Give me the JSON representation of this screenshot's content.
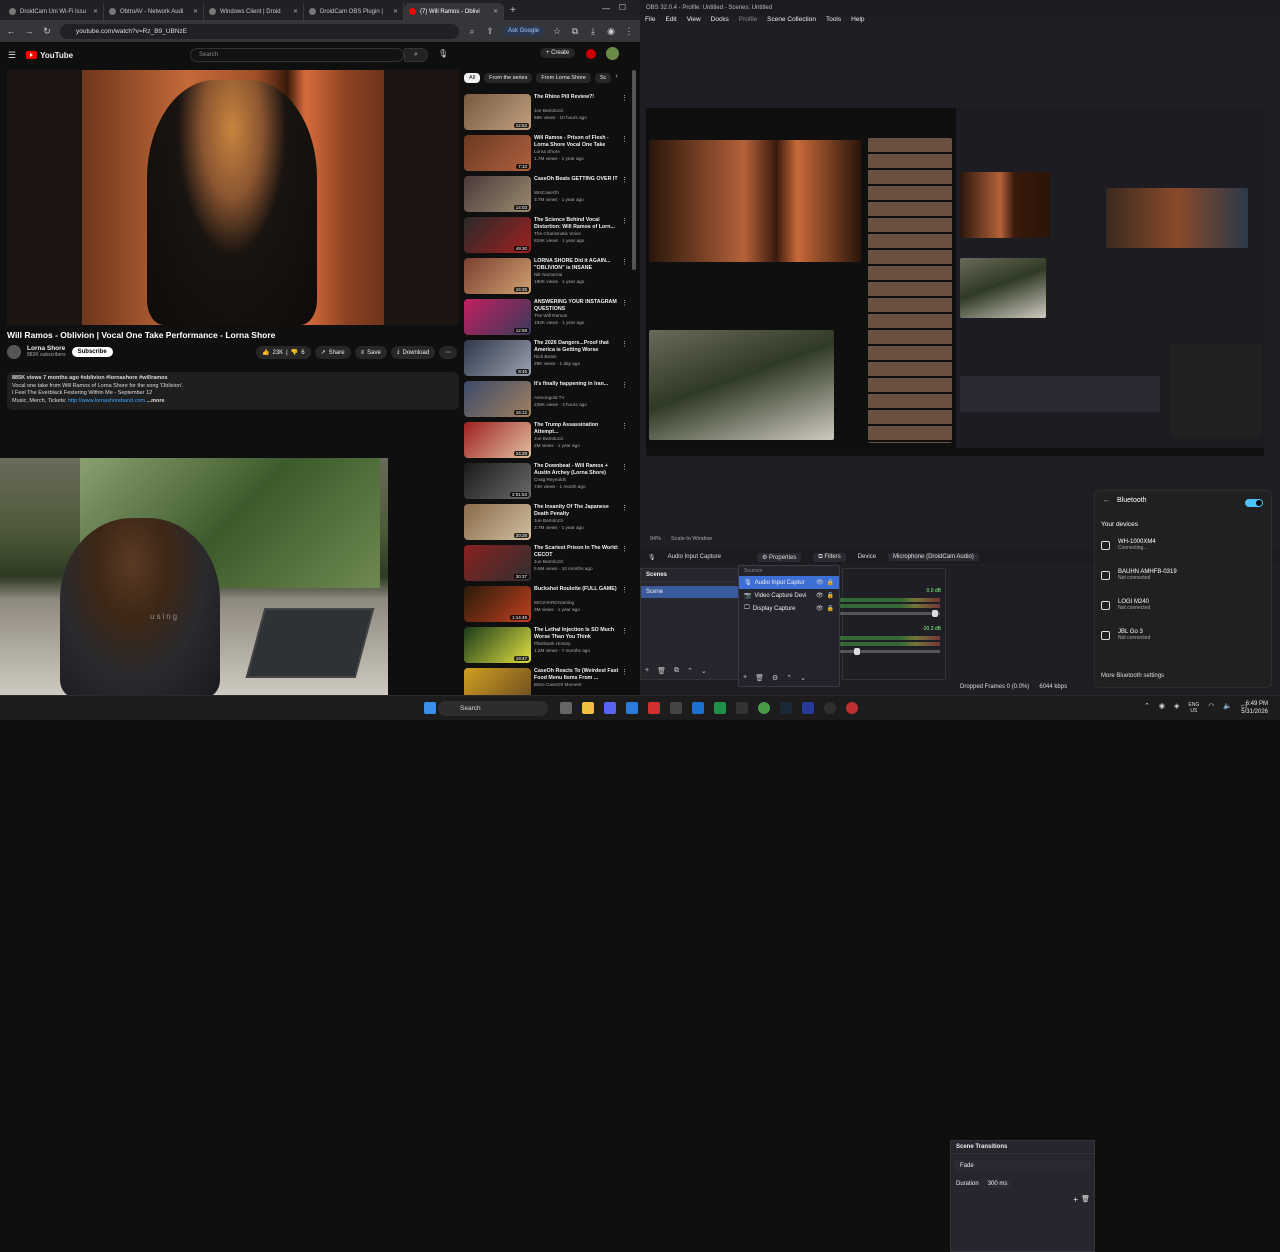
{
  "browser": {
    "tabs": [
      "DroidCam Uni Wi-Fi Issu",
      "ObtroAV - Network Audi",
      "Windows Client | Droid",
      "DroidCam OBS Plugin |",
      "(7) Will Ramos - Oblivi"
    ],
    "url": "youtube.com/watch?v=Rz_B9_UBNzE",
    "ask_google": "Ask Google"
  },
  "youtube": {
    "logo": "YouTube",
    "search_placeholder": "Search",
    "create": "+ Create",
    "video_title": "Will Ramos - Oblivion | Vocal One Take Performance - Lorna Shore",
    "channel": "Lorna Shore",
    "subs": "883K subscribers",
    "subscribe": "Subscribe",
    "likes": "23K",
    "dislikes": "6",
    "share": "Share",
    "save": "Save",
    "download": "Download",
    "desc_line1": "885K views  7 months ago  #oblivion #lornashore #willramos",
    "desc_line2": "Vocal one take from Will Ramos of Lorna Shore for the song 'Oblivion'.",
    "desc_line3": "I Feel The Everblack Festering Within Me - September 12",
    "desc_line4_prefix": "Music, Merch, Tickets: ",
    "desc_link": "http://www.lornashoreband.com",
    "desc_more": "...more",
    "chips": [
      "All",
      "From the series",
      "From Lorna Shore",
      "Sc"
    ],
    "recs": [
      {
        "title": "The Rhino Pill Review?!",
        "chan": "Joe Bartolozzi",
        "meta": "58K views · 10 hours ago",
        "dur": "12:52",
        "c1": "#7a5a40",
        "c2": "#c0a080"
      },
      {
        "title": "Will Ramos - Prison of Flesh - Lorna Shore Vocal One Take",
        "chan": "Lorna Shore",
        "meta": "1.7M views · 1 year ago",
        "dur": "7:10",
        "c1": "#6a3a20",
        "c2": "#b06040"
      },
      {
        "title": "CaseOh Beats GETTING OVER IT",
        "chan": "MrsCaseOh",
        "meta": "3.7M views · 1 year ago",
        "dur": "14:03",
        "c1": "#4a3a3a",
        "c2": "#9a8a70"
      },
      {
        "title": "The Science Behind Vocal Distortion: Will Ramos of Lorn...",
        "chan": "The Charismatic Voice",
        "meta": "816K views · 1 year ago",
        "dur": "49:30",
        "c1": "#2a2a2a",
        "c2": "#a02020"
      },
      {
        "title": "LORNA SHORE Did it AGAIN... \"OBLIVION\" is INSANE",
        "chan": "Nik Nocturnal",
        "meta": "190K views · 1 year ago",
        "dur": "16:35",
        "c1": "#7a4030",
        "c2": "#d0a070"
      },
      {
        "title": "ANSWERING YOUR INSTAGRAM QUESTIONS",
        "chan": "The Will Ramos",
        "meta": "192K views · 1 year ago",
        "dur": "12:58",
        "c1": "#c02060",
        "c2": "#3a3a5a"
      },
      {
        "title": "The 2026 Dangers...Proof that America is Getting Worse",
        "chan": "Rick Beato",
        "meta": "29K views · 1 day ago",
        "dur": "8:45",
        "c1": "#303a4a",
        "c2": "#9aa0b0"
      },
      {
        "title": "It's finally happening in Iran...",
        "chan": "Asmongold TV",
        "meta": "236K views · 3 hours ago",
        "dur": "16:12",
        "c1": "#3a4a6a",
        "c2": "#a08060"
      },
      {
        "title": "The Trump Assassination Attempt...",
        "chan": "Joe Bartolozzi",
        "meta": "2M views · 1 year ago",
        "dur": "24:29",
        "c1": "#a02020",
        "c2": "#e0c0a0"
      },
      {
        "title": "The Downbeat - Will Ramos + Austin Archey (Lorna Shore)",
        "chan": "Craig Reynolds",
        "meta": "74K views · 1 month ago",
        "dur": "2:01:53",
        "c1": "#1a1a1a",
        "c2": "#6a6a6a"
      },
      {
        "title": "The Insanity Of The Japanese Death Penalty",
        "chan": "Joe Bartolozzi",
        "meta": "3.7M views · 1 year ago",
        "dur": "20:28",
        "c1": "#8a6a4a",
        "c2": "#d0c0a0"
      },
      {
        "title": "The Scariest Prison In The World: CECOT",
        "chan": "Joe Bartolozzi",
        "meta": "5.6M views · 10 months ago",
        "dur": "30:37",
        "c1": "#8a2020",
        "c2": "#303030"
      },
      {
        "title": "Buckshot Roulette (FULL GAME)",
        "chan": "MrCrHARDGaming",
        "meta": "3M views · 1 year ago",
        "dur": "1:14:49",
        "c1": "#2a1a0a",
        "c2": "#c04020"
      },
      {
        "title": "The Lethal Injection Is SO Much Worse Than You Think",
        "chan": "Plainbank History",
        "meta": "1.2M views · 7 months ago",
        "dur": "19:47",
        "c1": "#1a3a1a",
        "c2": "#e0e040"
      },
      {
        "title": "CaseOh Reacts To (Weirdest Fast Food Menu Items From ...",
        "chan": "More CaseOh Moment",
        "meta": "",
        "dur": "",
        "c1": "#d0a020",
        "c2": "#6a4a20"
      }
    ]
  },
  "webcam": {
    "caption": "using"
  },
  "obs": {
    "title": "OBS 32.0.4 - Profile: Untitled - Scenes: Untitled",
    "menu": [
      "File",
      "Edit",
      "View",
      "Docks",
      "Profile",
      "Scene Collection",
      "Tools",
      "Help"
    ],
    "zoom": "94%",
    "scale": "Scale to Window",
    "source_name": "Audio Input Capture",
    "properties": "Properties",
    "filters": "Filters",
    "device_label": "Device",
    "device": "Microphone (DroidCam Audio)",
    "scenes_title": "Scenes",
    "scene": "Scene",
    "sources": [
      "Audio Input Captur",
      "Video Capture Devi",
      "Display Capture"
    ],
    "sources_hint": "Sources",
    "trans_title": "Scene Transitions",
    "trans_type": "Fade",
    "duration_label": "Duration",
    "duration": "300 ms",
    "db1": "0.0 dB",
    "db2": "-20.3 dB",
    "dropped": "Dropped Frames 0 (0.0%)",
    "kbps": "6044 kbps"
  },
  "bluetooth": {
    "title": "Bluetooth",
    "your_devices": "Your devices",
    "devices": [
      {
        "name": "WH-1000XM4",
        "status": "Connecting..."
      },
      {
        "name": "BAUHN AMHFB-0319",
        "status": "Not connected"
      },
      {
        "name": "LOGI M240",
        "status": "Not connected"
      },
      {
        "name": "JBL Go 3",
        "status": "Not connected"
      }
    ],
    "more": "More Bluetooth settings"
  },
  "taskbar": {
    "search": "Search",
    "lang1": "ENG",
    "lang2": "US",
    "time": "6:49 PM",
    "date": "5/31/2026"
  }
}
